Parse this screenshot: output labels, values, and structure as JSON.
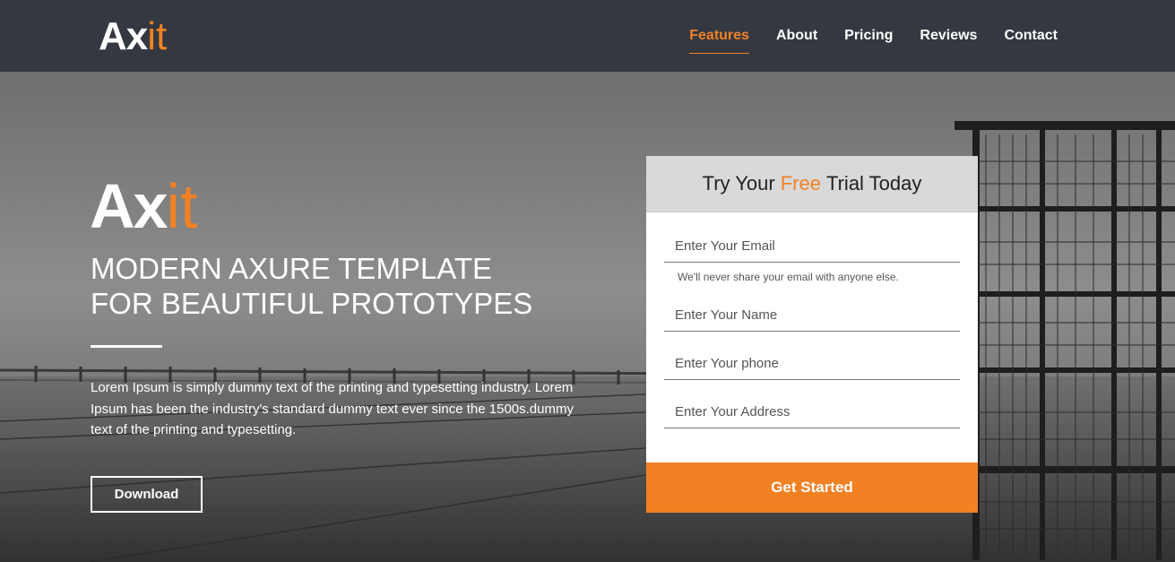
{
  "header": {
    "logo_main": "Ax",
    "logo_accent": "it",
    "nav": [
      {
        "label": "Features"
      },
      {
        "label": "About"
      },
      {
        "label": "Pricing"
      },
      {
        "label": "Reviews"
      },
      {
        "label": "Contact"
      }
    ]
  },
  "hero": {
    "logo_main": "Ax",
    "logo_accent": "it",
    "headline_line1": "MODERN AXURE TEMPLATE",
    "headline_line2": "FOR BEAUTIFUL PROTOTYPES",
    "description": "Lorem Ipsum is simply dummy text of the printing and typesetting industry. Lorem Ipsum has been the industry's standard dummy text ever since the 1500s.dummy text of the printing and typesetting.",
    "download_label": "Download"
  },
  "form": {
    "title_before": "Try Your",
    "title_highlight": "Free",
    "title_after": "Trial Today",
    "email_placeholder": "Enter Your Email",
    "email_hint": "We'll never share your email with anyone else.",
    "name_placeholder": "Enter Your Name",
    "phone_placeholder": "Enter Your phone",
    "address_placeholder": "Enter Your Address",
    "submit_label": "Get Started"
  },
  "colors": {
    "accent": "#f28124",
    "header_bg": "#343840"
  }
}
